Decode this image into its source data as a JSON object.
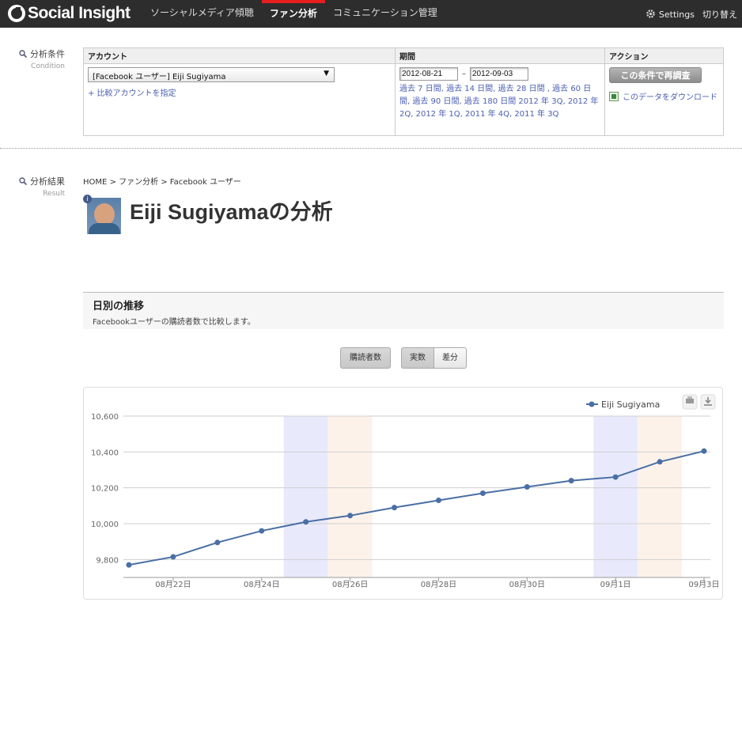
{
  "app": {
    "logo_text": "Social Insight"
  },
  "nav": {
    "items": [
      {
        "label": "ソーシャルメディア傾聴",
        "active": false
      },
      {
        "label": "ファン分析",
        "active": true
      },
      {
        "label": "コミュニケーション管理",
        "active": false
      }
    ],
    "settings_label": "Settings",
    "switch_label": "切り替え"
  },
  "condition": {
    "label_jp": "分析条件",
    "label_en": "Condition",
    "account_header": "アカウント",
    "period_header": "期間",
    "action_header": "アクション",
    "account_value": "[Facebook ユーザー] Eiji Sugiyama",
    "add_compare": "+ 比較アカウントを指定",
    "date_from": "2012-08-21",
    "date_sep": "–",
    "date_to": "2012-09-03",
    "period_links": "過去 7 日間, 過去 14 日間, 過去 28 日間 , 過去 60 日間, 過去 90 日間, 過去 180 日間 2012 年 3Q, 2012 年 2Q, 2012 年 1Q, 2011 年 4Q, 2011 年 3Q",
    "rerun_button": "この条件で再調査",
    "download_link": "このデータをダウンロード"
  },
  "result": {
    "label_jp": "分析結果",
    "label_en": "Result",
    "breadcrumb": "HOME > ファン分析 > Facebook ユーザー",
    "badge": "i",
    "title": "Eiji Sugiyamaの分析",
    "section_title": "日別の推移",
    "section_sub": "Facebookユーザーの購読者数で比較します。",
    "btn_subscribers": "購読者数",
    "btn_actual": "実数",
    "btn_diff": "差分"
  },
  "colors": {
    "series": "#4a6fa5",
    "weekend_sat": "#e8eafc",
    "weekend_sun": "#fdf2ea"
  },
  "chart_data": {
    "type": "line",
    "x": [
      "08/21",
      "08/22",
      "08/23",
      "08/24",
      "08/25",
      "08/26",
      "08/27",
      "08/28",
      "08/29",
      "08/30",
      "08/31",
      "09/01",
      "09/02",
      "09/03"
    ],
    "series": [
      {
        "name": "Eiji Sugiyama",
        "values": [
          9770,
          9815,
          9895,
          9960,
          10010,
          10045,
          10090,
          10130,
          10170,
          10205,
          10240,
          10260,
          10345,
          10405
        ]
      }
    ],
    "y_ticks": [
      "9,800",
      "10,000",
      "10,200",
      "10,400",
      "10,600"
    ],
    "y_tick_values": [
      9800,
      10000,
      10200,
      10400,
      10600
    ],
    "x_tick_labels": [
      "08月22日",
      "08月24日",
      "08月26日",
      "08月28日",
      "08月30日",
      "09月1日",
      "09月3日"
    ],
    "x_tick_index": [
      1,
      3,
      5,
      7,
      9,
      11,
      13
    ],
    "ylim": [
      9700,
      10600
    ],
    "weekends": [
      {
        "day": "saturday",
        "index": 4
      },
      {
        "day": "sunday",
        "index": 5
      },
      {
        "day": "saturday",
        "index": 11
      },
      {
        "day": "sunday",
        "index": 12
      }
    ],
    "grid": true,
    "legend": "top-right"
  }
}
